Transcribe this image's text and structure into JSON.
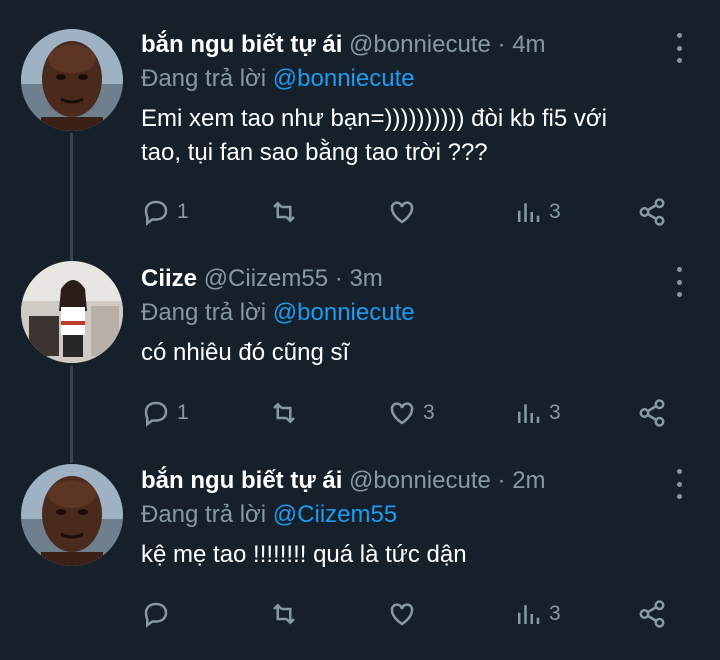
{
  "colors": {
    "background": "#15202b",
    "secondary_text": "#8899a6",
    "mention": "#1d9bf0",
    "thread_line": "#38444d"
  },
  "tweets": [
    {
      "display_name": "bắn ngu biết tự ái",
      "handle": "@bonniecute",
      "dot": "·",
      "time": "4m",
      "reply_prefix": "Đang trả lời",
      "reply_to": "@bonniecute",
      "text_line1": "Emi xem tao như bạn=)))))))))) đòi kb fi5 với",
      "text_line2": "tao, tụi fan sao bằng tao trời ???",
      "replies": "1",
      "retweets": "",
      "likes": "",
      "views": "3",
      "avatar": "avatar-bald-man"
    },
    {
      "display_name": "Ciize",
      "handle": "@Ciizem55",
      "dot": "·",
      "time": "3m",
      "reply_prefix": "Đang trả lời",
      "reply_to": "@bonniecute",
      "text_line1": "có nhiêu đó cũng sĩ",
      "text_line2": "",
      "replies": "1",
      "retweets": "",
      "likes": "3",
      "views": "3",
      "avatar": "avatar-girl"
    },
    {
      "display_name": "bắn ngu biết tự ái",
      "handle": "@bonniecute",
      "dot": "·",
      "time": "2m",
      "reply_prefix": "Đang trả lời",
      "reply_to": "@Ciizem55",
      "text_line1": "kệ mẹ tao !!!!!!!! quá là tức dận",
      "text_line2": "",
      "replies": "",
      "retweets": "",
      "likes": "",
      "views": "3",
      "avatar": "avatar-bald-man"
    }
  ]
}
